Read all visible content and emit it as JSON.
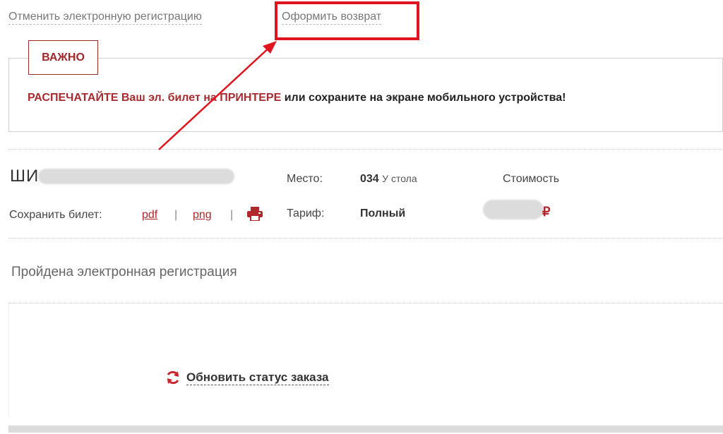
{
  "top_links": {
    "cancel_registration": "Отменить электронную регистрацию",
    "make_return": "Оформить возврат"
  },
  "notice": {
    "tag": "ВАЖНО",
    "highlight": "РАСПЕЧАТАЙТЕ Ваш эл. билет на ПРИНТЕРЕ",
    "rest": " или сохраните на экране мобильного устройства!"
  },
  "ticket": {
    "passenger_name_visible": "ШИ",
    "save_label": "Сохранить билет:",
    "formats": [
      "pdf",
      "png"
    ],
    "separator": "|",
    "seat_label": "Место:",
    "seat_number": "034",
    "seat_type": "У стола",
    "tariff_label": "Тариф:",
    "tariff_value": "Полный",
    "cost_label": "Стоимость",
    "currency": "₽"
  },
  "registration_status": "Пройдена электронная регистрация",
  "refresh_button": "Обновить статус заказа",
  "colors": {
    "accent_red": "#a72b2e",
    "annotation_red": "#e0141e"
  }
}
